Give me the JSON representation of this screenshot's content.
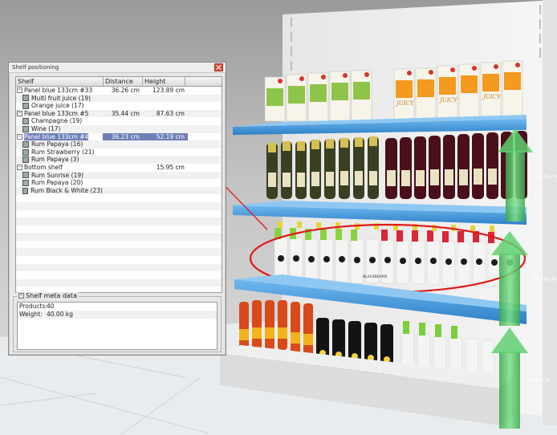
{
  "window": {
    "title": "Shelf positioning",
    "columns": [
      "Shelf",
      "Distance",
      "Height"
    ],
    "rows": [
      {
        "kind": "group",
        "label": "Panel blue 133cm #33",
        "distance": "36.26 cm",
        "height": "123.89 cm"
      },
      {
        "kind": "item",
        "label": "Multi fruit juice (19)",
        "distance": "",
        "height": ""
      },
      {
        "kind": "item",
        "label": "Orange juice (17)",
        "distance": "",
        "height": ""
      },
      {
        "kind": "group",
        "label": "Panel blue 133cm #5",
        "distance": "35.44 cm",
        "height": "87.63 cm"
      },
      {
        "kind": "item",
        "label": "Champagne (19)",
        "distance": "",
        "height": ""
      },
      {
        "kind": "item",
        "label": "Wine (17)",
        "distance": "",
        "height": ""
      },
      {
        "kind": "group",
        "label": "Panel blue 133cm #4",
        "distance": "36.23 cm",
        "height": "52.19 cm",
        "selected": true
      },
      {
        "kind": "item",
        "label": "Rum Papaya (16)",
        "distance": "",
        "height": ""
      },
      {
        "kind": "item",
        "label": "Rum Strawberry (21)",
        "distance": "",
        "height": ""
      },
      {
        "kind": "item",
        "label": "Rum Papaya (3)",
        "distance": "",
        "height": ""
      },
      {
        "kind": "group",
        "label": "Bottom shelf",
        "distance": "",
        "height": "15.95 cm"
      },
      {
        "kind": "item",
        "label": "Rum Sunrise (19)",
        "distance": "",
        "height": ""
      },
      {
        "kind": "item",
        "label": "Rum Papaya (20)",
        "distance": "",
        "height": ""
      },
      {
        "kind": "item",
        "label": "Rum Black & White (23)",
        "distance": "",
        "height": ""
      }
    ],
    "meta": {
      "legend": "Shelf meta data",
      "products_label": "Products:",
      "products_value": "40",
      "weight_label": "Weight:",
      "weight_value": "40.00 kg"
    }
  },
  "scene": {
    "distance_labels": [
      "36.26 cm",
      "35.44 cm",
      "36.23 cm"
    ],
    "juice_brand": "JUICY",
    "rum_brand": "BLACKBEARD",
    "colors": {
      "shelf_blue": "#4a9fe0",
      "arrow_green": "#47c45a",
      "highlight_red": "#e01818",
      "gondola_grey": "#d9d9d9"
    }
  }
}
